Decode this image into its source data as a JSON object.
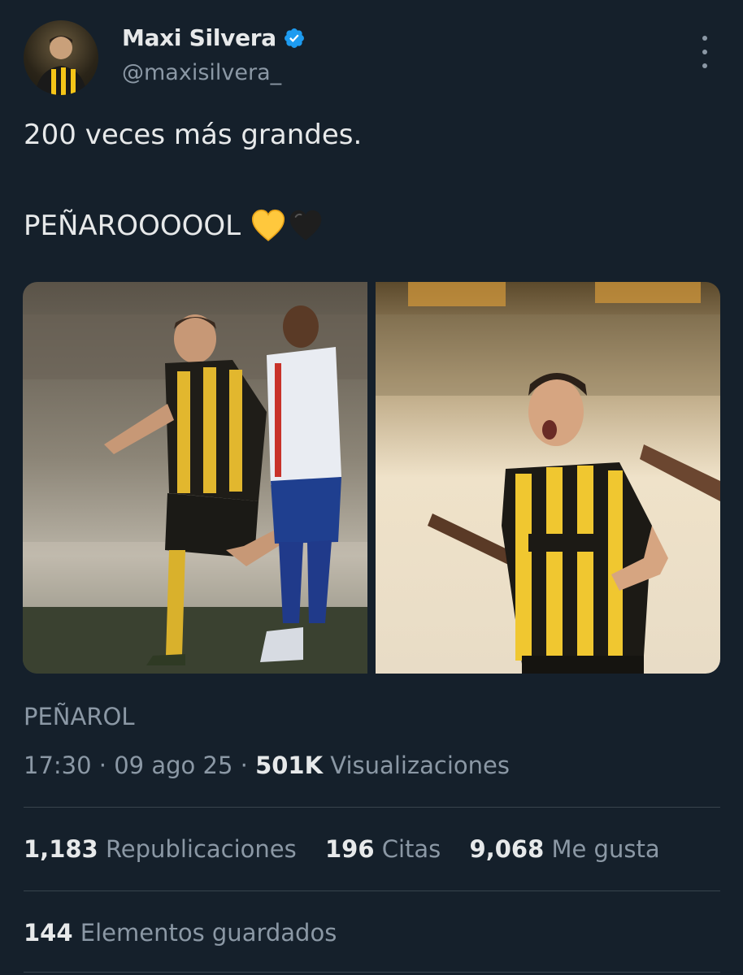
{
  "author": {
    "name": "Maxi Silvera",
    "handle": "@maxisilvera_",
    "avatar_icon": "player-photo-avatar",
    "verified_icon": "verified-badge-icon",
    "verified_color": "#1d9bf0"
  },
  "tweet": {
    "line1": "200 veces más grandes.",
    "line2": "PEÑAROOOOOL",
    "emojis": [
      "yellow-heart",
      "black-heart"
    ]
  },
  "media": [
    {
      "icon": "photo-player-celebrating-kissing-badge"
    },
    {
      "icon": "photo-player-shouting-celebration"
    }
  ],
  "label": "PEÑAROL",
  "meta": {
    "time": "17:30",
    "sep1": " · ",
    "date": "09 ago 25",
    "sep2": " · ",
    "views_count": "501K",
    "views_label": "Visualizaciones"
  },
  "stats": {
    "reposts_count": "1,183",
    "reposts_label": "Republicaciones",
    "quotes_count": "196",
    "quotes_label": "Citas",
    "likes_count": "9,068",
    "likes_label": "Me gusta"
  },
  "bookmarks": {
    "count": "144",
    "label": "Elementos guardados"
  },
  "colors": {
    "background": "#15202b",
    "text": "#e7e9ea",
    "muted": "#8b98a5",
    "divider": "#38444d",
    "penarol_yellow": "#f5c518"
  }
}
